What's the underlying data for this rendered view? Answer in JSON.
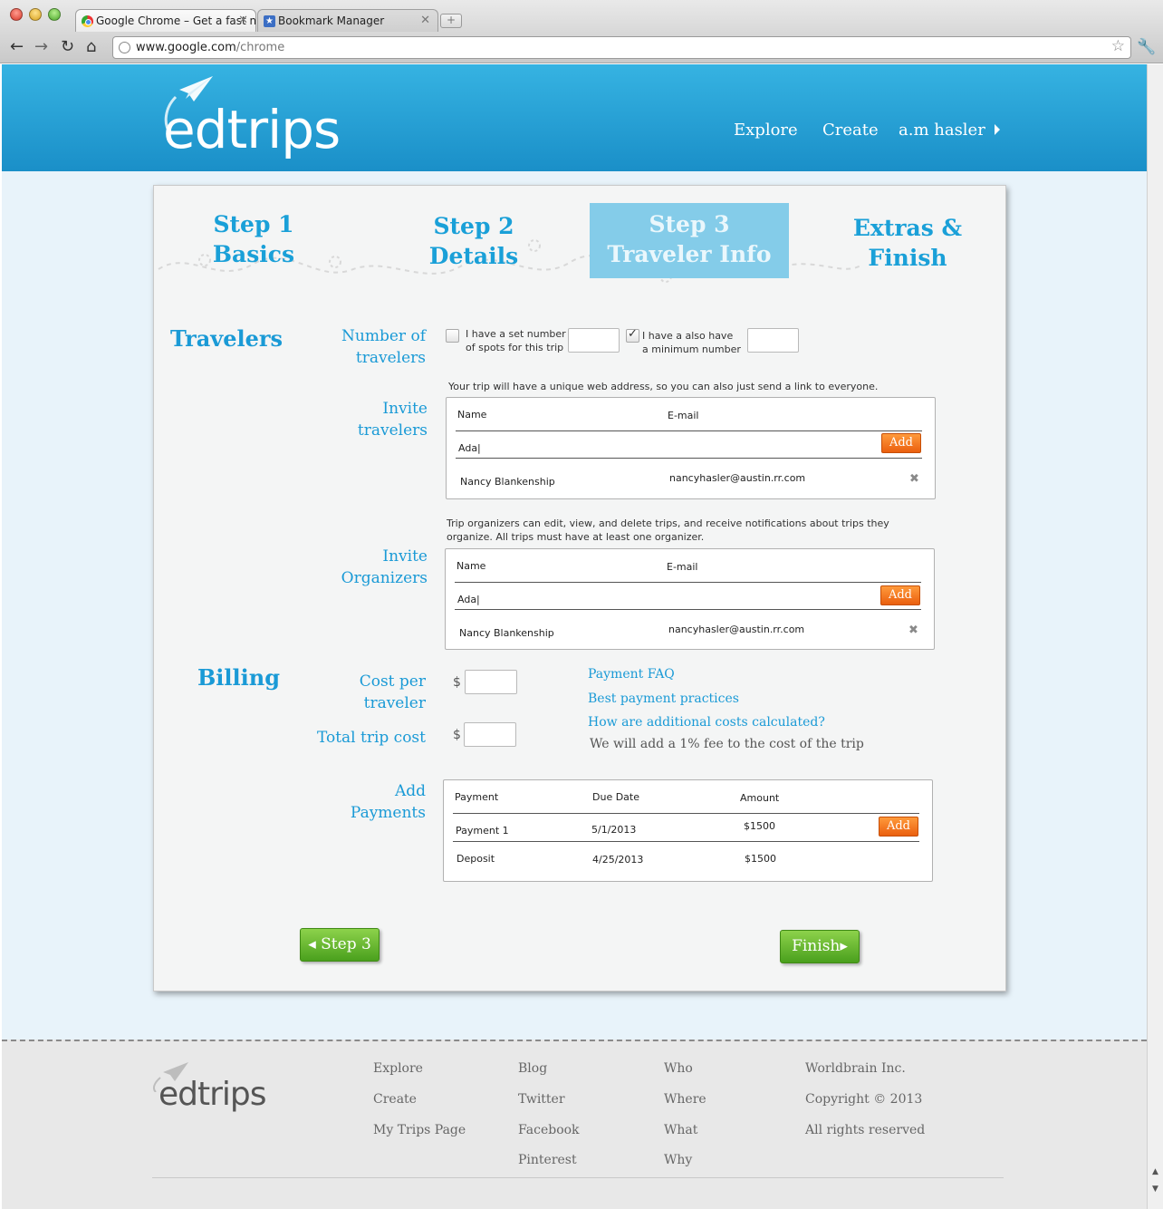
{
  "browser": {
    "tabs": [
      {
        "title": "Google Chrome – Get a fast n"
      },
      {
        "title": "Bookmark Manager"
      }
    ],
    "url_domain": "www.google.com",
    "url_path": "/chrome"
  },
  "header": {
    "logo": "edtrips",
    "nav": [
      "Explore",
      "Create",
      "a.m hasler"
    ]
  },
  "steps": [
    {
      "line1": "Step 1",
      "line2": "Basics"
    },
    {
      "line1": "Step 2",
      "line2": "Details"
    },
    {
      "line1": "Step 3",
      "line2": "Traveler Info"
    },
    {
      "line1": "Extras &",
      "line2": "Finish"
    }
  ],
  "travelers": {
    "section_title": "Travelers",
    "number_label_1": "Number of",
    "number_label_2": "travelers",
    "set_number_1": "I have a set number",
    "set_number_2": "of spots for this trip",
    "minimum_1": "I have a also have",
    "minimum_2": "a minimum number",
    "set_number_checked": false,
    "minimum_checked": true
  },
  "invite_travelers": {
    "label_1": "Invite",
    "label_2": "travelers",
    "note": "Your trip will have a unique web address, so you can also just send a link to everyone.",
    "col_name": "Name",
    "col_email": "E-mail",
    "input_value": "Ada|",
    "add": "Add",
    "rows": [
      {
        "name": "Nancy Blankenship",
        "email": "nancyhasler@austin.rr.com"
      }
    ]
  },
  "invite_organizers": {
    "label_1": "Invite",
    "label_2": "Organizers",
    "note_1": "Trip organizers can edit, view, and delete trips, and receive notifications about trips they",
    "note_2": "organize. All trips must have at least one organizer.",
    "col_name": "Name",
    "col_email": "E-mail",
    "input_value": "Ada|",
    "add": "Add",
    "rows": [
      {
        "name": "Nancy Blankenship",
        "email": "nancyhasler@austin.rr.com"
      }
    ]
  },
  "billing": {
    "section_title": "Billing",
    "cost_label_1": "Cost per",
    "cost_label_2": "traveler",
    "total_label": "Total trip cost",
    "currency": "$",
    "links": [
      "Payment FAQ",
      "Best payment practices",
      "How are additional costs calculated?"
    ],
    "fee_note": "We will add a 1% fee to the cost of the trip"
  },
  "payments": {
    "label_1": "Add",
    "label_2": "Payments",
    "col_payment": "Payment",
    "col_due": "Due Date",
    "col_amount": "Amount",
    "add": "Add",
    "rows": [
      {
        "payment": "Payment 1",
        "due": "5/1/2013",
        "amount": "$1500"
      },
      {
        "payment": "Deposit",
        "due": "4/25/2013",
        "amount": "$1500"
      }
    ]
  },
  "nav_buttons": {
    "back": "Step 3",
    "finish": "Finish"
  },
  "footer": {
    "logo": "edtrips",
    "col1": [
      "Explore",
      "Create",
      "My Trips Page"
    ],
    "col2": [
      "Blog",
      "Twitter",
      "Facebook",
      "Pinterest"
    ],
    "col3": [
      "Who",
      "Where",
      "What",
      "Why"
    ],
    "col4": [
      "Worldbrain Inc.",
      "Copyright © 2013",
      "All rights reserved"
    ]
  },
  "colors": {
    "brand_blue": "#1a9ad6",
    "header_blue": "#29a3d8",
    "add_orange": "#f07a20",
    "button_green": "#6cbf34"
  }
}
